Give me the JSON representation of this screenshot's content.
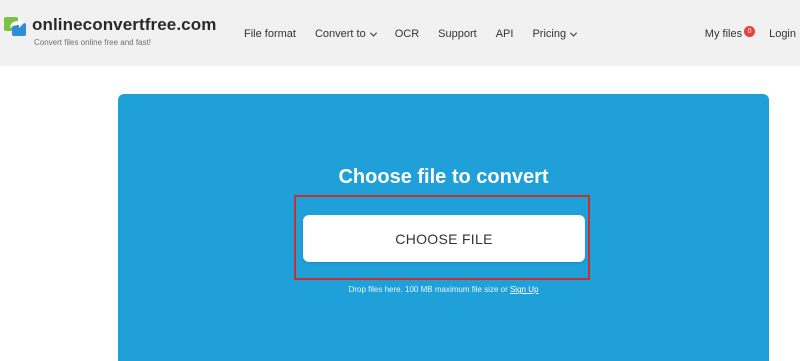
{
  "brand": {
    "name": "onlineconvertfree.com",
    "tagline": "Convert files online free and fast!",
    "colors": {
      "accent": "#1fa0d8",
      "logo_green": "#7cc242",
      "logo_blue": "#2f8fd6",
      "badge": "#e8413a",
      "highlight": "#c9302c"
    }
  },
  "nav": {
    "items": [
      {
        "label": "File format"
      },
      {
        "label": "Convert to"
      },
      {
        "label": "OCR"
      },
      {
        "label": "Support"
      },
      {
        "label": "API"
      },
      {
        "label": "Pricing"
      }
    ],
    "my_files_label": "My files",
    "my_files_count": "0",
    "login_label": "Login"
  },
  "converter": {
    "title": "Choose file to convert",
    "button_label": "CHOOSE FILE",
    "hint_text": "Drop files here. 100 MB maximum file size or",
    "signup_label": "Sign Up"
  }
}
